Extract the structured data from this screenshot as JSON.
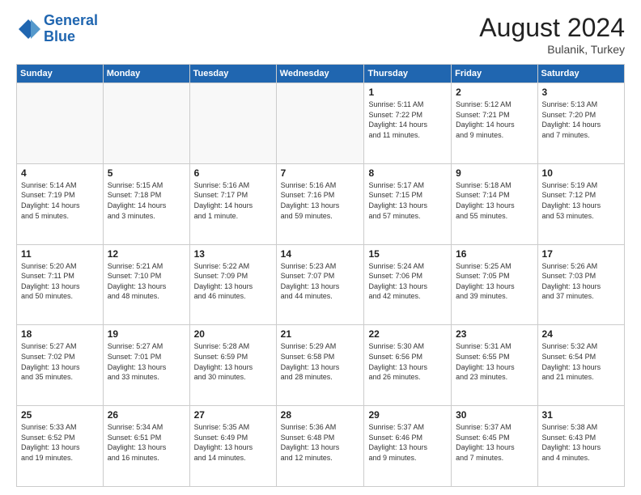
{
  "logo": {
    "line1": "General",
    "line2": "Blue"
  },
  "title": "August 2024",
  "location": "Bulanik, Turkey",
  "header": {
    "days": [
      "Sunday",
      "Monday",
      "Tuesday",
      "Wednesday",
      "Thursday",
      "Friday",
      "Saturday"
    ]
  },
  "weeks": [
    [
      {
        "day": "",
        "info": ""
      },
      {
        "day": "",
        "info": ""
      },
      {
        "day": "",
        "info": ""
      },
      {
        "day": "",
        "info": ""
      },
      {
        "day": "1",
        "info": "Sunrise: 5:11 AM\nSunset: 7:22 PM\nDaylight: 14 hours\nand 11 minutes."
      },
      {
        "day": "2",
        "info": "Sunrise: 5:12 AM\nSunset: 7:21 PM\nDaylight: 14 hours\nand 9 minutes."
      },
      {
        "day": "3",
        "info": "Sunrise: 5:13 AM\nSunset: 7:20 PM\nDaylight: 14 hours\nand 7 minutes."
      }
    ],
    [
      {
        "day": "4",
        "info": "Sunrise: 5:14 AM\nSunset: 7:19 PM\nDaylight: 14 hours\nand 5 minutes."
      },
      {
        "day": "5",
        "info": "Sunrise: 5:15 AM\nSunset: 7:18 PM\nDaylight: 14 hours\nand 3 minutes."
      },
      {
        "day": "6",
        "info": "Sunrise: 5:16 AM\nSunset: 7:17 PM\nDaylight: 14 hours\nand 1 minute."
      },
      {
        "day": "7",
        "info": "Sunrise: 5:16 AM\nSunset: 7:16 PM\nDaylight: 13 hours\nand 59 minutes."
      },
      {
        "day": "8",
        "info": "Sunrise: 5:17 AM\nSunset: 7:15 PM\nDaylight: 13 hours\nand 57 minutes."
      },
      {
        "day": "9",
        "info": "Sunrise: 5:18 AM\nSunset: 7:14 PM\nDaylight: 13 hours\nand 55 minutes."
      },
      {
        "day": "10",
        "info": "Sunrise: 5:19 AM\nSunset: 7:12 PM\nDaylight: 13 hours\nand 53 minutes."
      }
    ],
    [
      {
        "day": "11",
        "info": "Sunrise: 5:20 AM\nSunset: 7:11 PM\nDaylight: 13 hours\nand 50 minutes."
      },
      {
        "day": "12",
        "info": "Sunrise: 5:21 AM\nSunset: 7:10 PM\nDaylight: 13 hours\nand 48 minutes."
      },
      {
        "day": "13",
        "info": "Sunrise: 5:22 AM\nSunset: 7:09 PM\nDaylight: 13 hours\nand 46 minutes."
      },
      {
        "day": "14",
        "info": "Sunrise: 5:23 AM\nSunset: 7:07 PM\nDaylight: 13 hours\nand 44 minutes."
      },
      {
        "day": "15",
        "info": "Sunrise: 5:24 AM\nSunset: 7:06 PM\nDaylight: 13 hours\nand 42 minutes."
      },
      {
        "day": "16",
        "info": "Sunrise: 5:25 AM\nSunset: 7:05 PM\nDaylight: 13 hours\nand 39 minutes."
      },
      {
        "day": "17",
        "info": "Sunrise: 5:26 AM\nSunset: 7:03 PM\nDaylight: 13 hours\nand 37 minutes."
      }
    ],
    [
      {
        "day": "18",
        "info": "Sunrise: 5:27 AM\nSunset: 7:02 PM\nDaylight: 13 hours\nand 35 minutes."
      },
      {
        "day": "19",
        "info": "Sunrise: 5:27 AM\nSunset: 7:01 PM\nDaylight: 13 hours\nand 33 minutes."
      },
      {
        "day": "20",
        "info": "Sunrise: 5:28 AM\nSunset: 6:59 PM\nDaylight: 13 hours\nand 30 minutes."
      },
      {
        "day": "21",
        "info": "Sunrise: 5:29 AM\nSunset: 6:58 PM\nDaylight: 13 hours\nand 28 minutes."
      },
      {
        "day": "22",
        "info": "Sunrise: 5:30 AM\nSunset: 6:56 PM\nDaylight: 13 hours\nand 26 minutes."
      },
      {
        "day": "23",
        "info": "Sunrise: 5:31 AM\nSunset: 6:55 PM\nDaylight: 13 hours\nand 23 minutes."
      },
      {
        "day": "24",
        "info": "Sunrise: 5:32 AM\nSunset: 6:54 PM\nDaylight: 13 hours\nand 21 minutes."
      }
    ],
    [
      {
        "day": "25",
        "info": "Sunrise: 5:33 AM\nSunset: 6:52 PM\nDaylight: 13 hours\nand 19 minutes."
      },
      {
        "day": "26",
        "info": "Sunrise: 5:34 AM\nSunset: 6:51 PM\nDaylight: 13 hours\nand 16 minutes."
      },
      {
        "day": "27",
        "info": "Sunrise: 5:35 AM\nSunset: 6:49 PM\nDaylight: 13 hours\nand 14 minutes."
      },
      {
        "day": "28",
        "info": "Sunrise: 5:36 AM\nSunset: 6:48 PM\nDaylight: 13 hours\nand 12 minutes."
      },
      {
        "day": "29",
        "info": "Sunrise: 5:37 AM\nSunset: 6:46 PM\nDaylight: 13 hours\nand 9 minutes."
      },
      {
        "day": "30",
        "info": "Sunrise: 5:37 AM\nSunset: 6:45 PM\nDaylight: 13 hours\nand 7 minutes."
      },
      {
        "day": "31",
        "info": "Sunrise: 5:38 AM\nSunset: 6:43 PM\nDaylight: 13 hours\nand 4 minutes."
      }
    ]
  ]
}
